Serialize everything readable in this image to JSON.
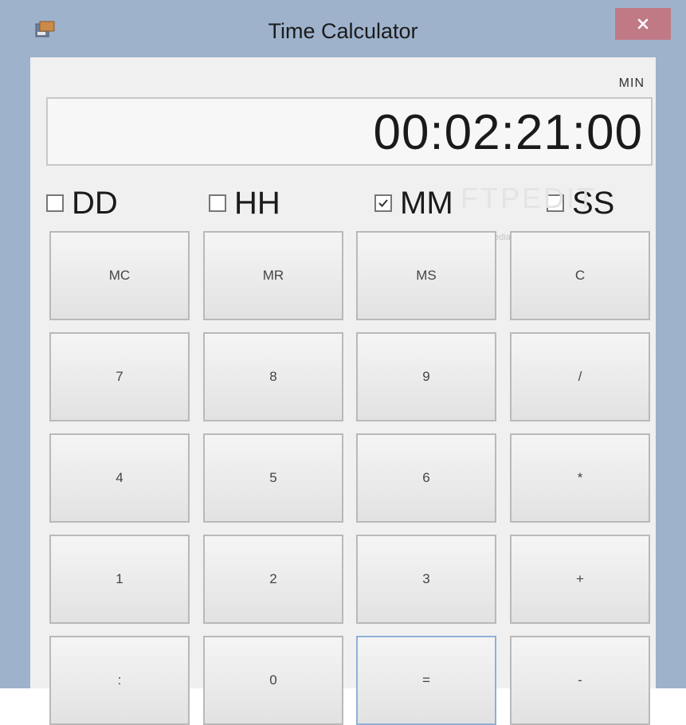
{
  "window": {
    "title": "Time Calculator",
    "close_label": "x"
  },
  "display": {
    "mode": "MIN",
    "value": "00:02:21:00"
  },
  "units": [
    {
      "label": "DD",
      "checked": false
    },
    {
      "label": "HH",
      "checked": false
    },
    {
      "label": "MM",
      "checked": true
    },
    {
      "label": "SS",
      "checked": false
    }
  ],
  "watermark": {
    "text": "FTPEDIT",
    "url": "www.softpedia.com"
  },
  "keypad": {
    "rows": [
      [
        "MC",
        "MR",
        "MS",
        "C"
      ],
      [
        "7",
        "8",
        "9",
        "/"
      ],
      [
        "4",
        "5",
        "6",
        "*"
      ],
      [
        "1",
        "2",
        "3",
        "+"
      ],
      [
        ":",
        "0",
        "=",
        "-"
      ]
    ]
  },
  "colors": {
    "frame": "#9eb2cc",
    "close": "#c07a86",
    "client": "#f0f0f0"
  },
  "icons": {
    "app": "app-icon",
    "close": "close-icon",
    "check": "check-icon"
  }
}
